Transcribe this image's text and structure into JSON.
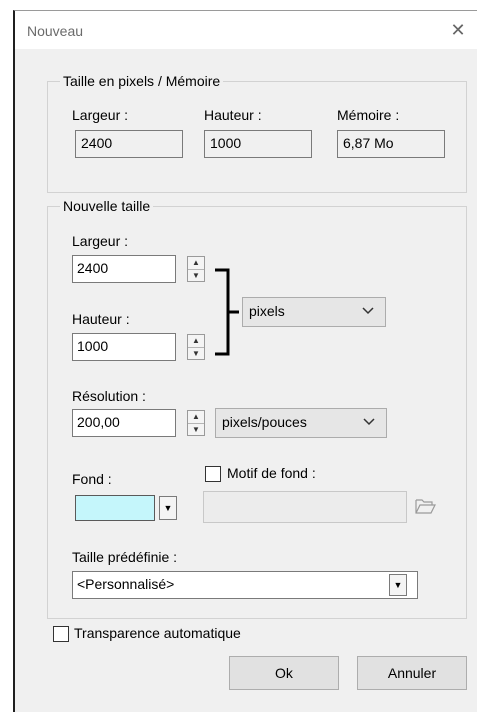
{
  "window": {
    "title": "Nouveau",
    "close_glyph": "✕"
  },
  "pixel_memory": {
    "legend": "Taille en pixels / Mémoire",
    "width_label": "Largeur :",
    "width_value": "2400",
    "height_label": "Hauteur :",
    "height_value": "1000",
    "memory_label": "Mémoire :",
    "memory_value": "6,87 Mo"
  },
  "new_size": {
    "legend": "Nouvelle taille",
    "width_label": "Largeur :",
    "width_value": "2400",
    "height_label": "Hauteur :",
    "height_value": "1000",
    "unit_select": "pixels",
    "resolution_label": "Résolution :",
    "resolution_value": "200,00",
    "resolution_unit": "pixels/pouces",
    "background_label": "Fond :",
    "background_color": "#c5f6fb",
    "pattern_label": "Motif de fond :",
    "pattern_checked": false,
    "folder_icon": "folder-open-icon",
    "preset_label": "Taille prédéfinie :",
    "preset_value": "<Personnalisé>"
  },
  "auto_transparency": {
    "label": "Transparence automatique",
    "checked": false
  },
  "buttons": {
    "ok": "Ok",
    "cancel": "Annuler"
  }
}
